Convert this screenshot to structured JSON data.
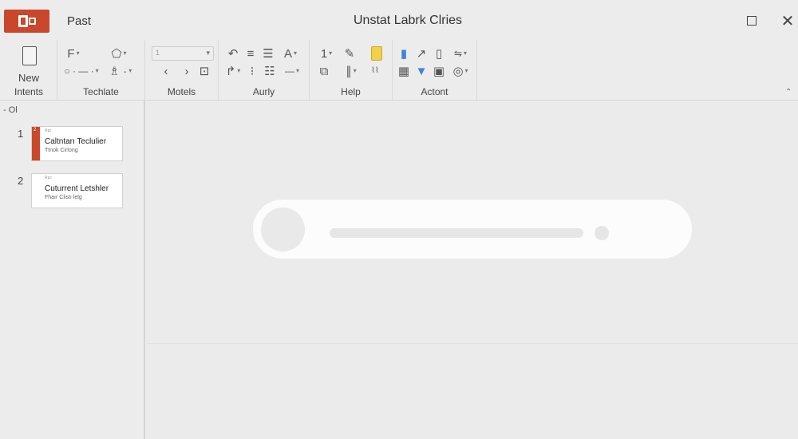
{
  "titlebar": {
    "app_label": "Past",
    "window_title": "Unstat Labrk Clries",
    "maximize_icon": "maximize-icon",
    "close_icon": "close-icon"
  },
  "ribbon": {
    "new_button": {
      "line1": "New",
      "line2": "Intents"
    },
    "groups": [
      {
        "label": "Techlate"
      },
      {
        "label": "Motels"
      },
      {
        "label": "Aurly"
      },
      {
        "label": "Help"
      },
      {
        "label": "Actont"
      }
    ],
    "accent_colors": {
      "brand": "#c9472a",
      "highlight_yellow": "#f2d04a",
      "blue": "#3f86d6"
    }
  },
  "slides_pane": {
    "section_label": "- Ol",
    "slides": [
      {
        "number": "1",
        "corner": "2",
        "tiny": "Rpt",
        "title": "Caltntarı Teclulier",
        "subtitle": "Ttnok Cirlong"
      },
      {
        "number": "2",
        "corner": "",
        "tiny": "Rpc",
        "title": "Cuturrent Letshler",
        "subtitle": "Fhaır Clistı lelg"
      }
    ]
  }
}
